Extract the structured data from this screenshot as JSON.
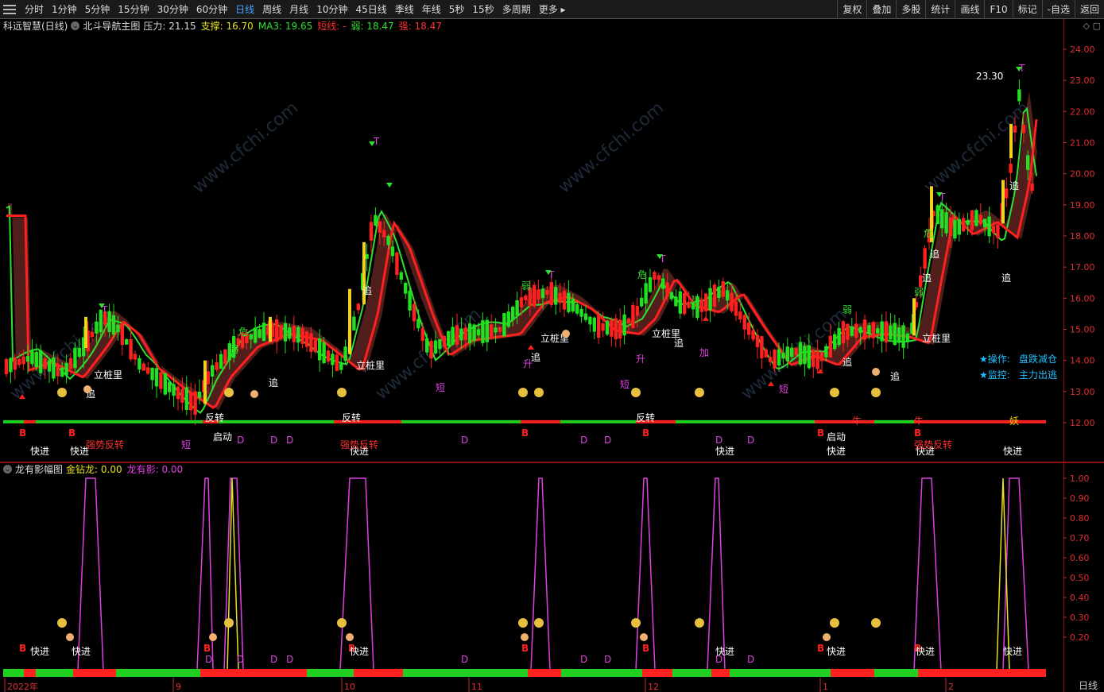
{
  "toolbar": {
    "tabs": [
      "分时",
      "1分钟",
      "5分钟",
      "15分钟",
      "30分钟",
      "60分钟",
      "日线",
      "周线",
      "月线",
      "10分钟",
      "45日线",
      "季线",
      "年线",
      "5秒",
      "15秒",
      "多周期",
      "更多 ▸"
    ],
    "active_tab": "日线",
    "right_buttons": [
      "复权",
      "叠加",
      "多股",
      "统计",
      "画线",
      "F10",
      "标记",
      "-自选",
      "返回"
    ]
  },
  "main_legend": {
    "name": "科远智慧(日线)",
    "indicator": "北斗导航主图",
    "items": [
      {
        "text": "压力: 21.15",
        "color": "#dcdcdc"
      },
      {
        "text": "支撑: 16.70",
        "color": "#e8e020"
      },
      {
        "text": "MA3: 19.65",
        "color": "#30e030"
      },
      {
        "text": "短线: -",
        "color": "#ff3030"
      },
      {
        "text": "弱: 18.47",
        "color": "#30e030"
      },
      {
        "text": "强: 18.47",
        "color": "#ff3030"
      }
    ]
  },
  "sub_legend": {
    "name": "龙有影幅图",
    "items": [
      {
        "text": "金钻龙: 0.00",
        "color": "#e8e020"
      },
      {
        "text": "龙有影: 0.00",
        "color": "#e040e0"
      }
    ]
  },
  "main_axis": [
    "24.00",
    "23.00",
    "22.00",
    "21.00",
    "20.00",
    "19.00",
    "18.00",
    "17.00",
    "16.00",
    "15.00",
    "14.00",
    "13.00",
    "12.00"
  ],
  "sub_axis": [
    "1.00",
    "0.90",
    "0.80",
    "0.70",
    "0.60",
    "0.50",
    "0.40",
    "0.30",
    "0.20"
  ],
  "date_axis": [
    "2022年",
    "9",
    "10",
    "11",
    "12",
    "1",
    "2"
  ],
  "bottom_label": "日线",
  "price_marker": "23.30",
  "right_notes": [
    {
      "label": "★操作:",
      "value": "盘跌减仓"
    },
    {
      "label": "★监控:",
      "value": "主力出逃"
    }
  ],
  "watermark": "www.cfchi.com",
  "corner_buttons": "◇ ▢"
}
